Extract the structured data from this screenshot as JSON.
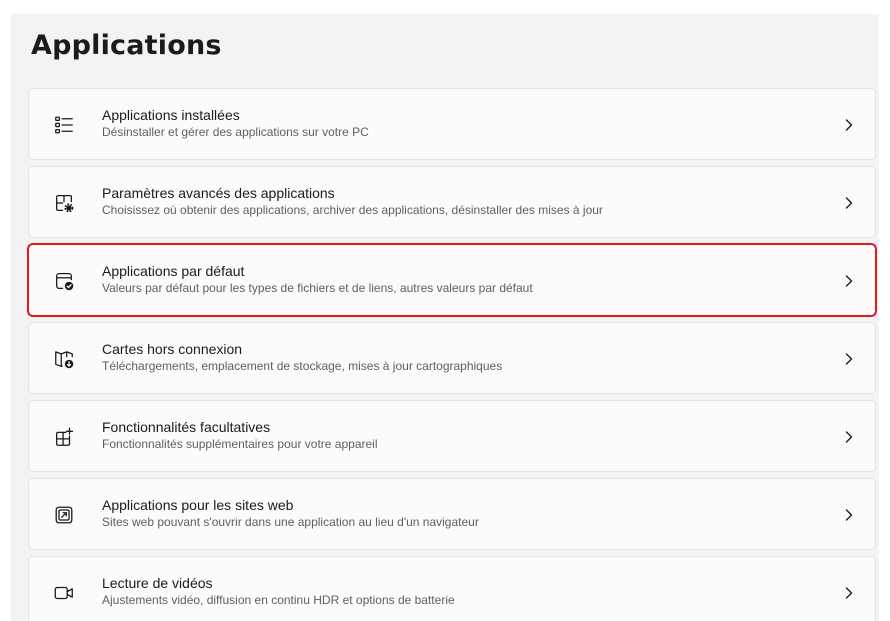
{
  "page": {
    "title": "Applications"
  },
  "colors": {
    "background": "#f3f3f3",
    "card": "#fbfbfb",
    "highlight": "#e0191e"
  },
  "items": [
    {
      "title": "Applications installées",
      "description": "Désinstaller et gérer des applications sur votre PC",
      "icon": "list-icon"
    },
    {
      "title": "Paramètres avancés des applications",
      "description": "Choisissez où obtenir des applications, archiver des applications, désinstaller des mises à jour",
      "icon": "app-settings-gear-icon"
    },
    {
      "title": "Applications par défaut",
      "description": "Valeurs par défaut pour les types de fichiers et de liens, autres valeurs par défaut",
      "icon": "default-app-check-icon",
      "highlighted": true
    },
    {
      "title": "Cartes hors connexion",
      "description": "Téléchargements, emplacement de stockage, mises à jour cartographiques",
      "icon": "map-download-icon"
    },
    {
      "title": "Fonctionnalités facultatives",
      "description": "Fonctionnalités supplémentaires pour votre appareil",
      "icon": "add-feature-grid-icon"
    },
    {
      "title": "Applications pour les sites web",
      "description": "Sites web pouvant s'ouvrir dans une application au lieu d'un navigateur",
      "icon": "open-in-app-icon"
    },
    {
      "title": "Lecture de vidéos",
      "description": "Ajustements vidéo, diffusion en continu HDR et options de batterie",
      "icon": "video-camera-icon"
    }
  ]
}
